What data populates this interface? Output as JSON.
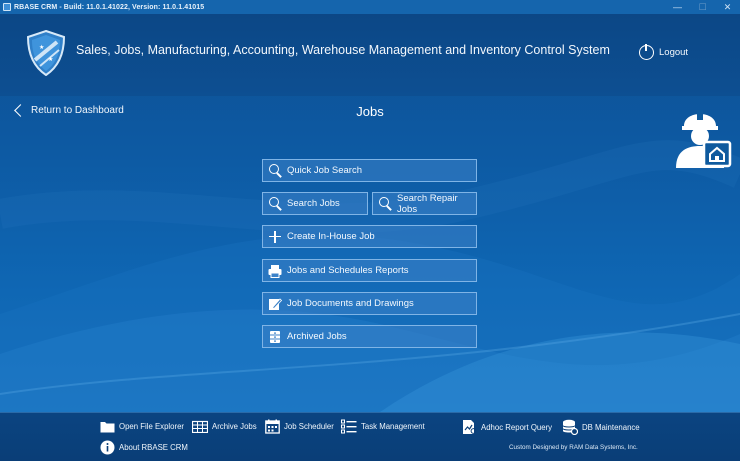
{
  "window": {
    "title": "RBASE CRM - Build: 11.0.1.41022, Version: 11.0.1.41015",
    "controls": {
      "minimize": "—",
      "maximize": "☐",
      "close": "✕"
    }
  },
  "header": {
    "title": "Sales, Jobs, Manufacturing, Accounting, Warehouse Management and Inventory Control System",
    "logout_label": "Logout"
  },
  "nav": {
    "back_label": "Return to Dashboard",
    "page_title": "Jobs"
  },
  "menu": {
    "quick_job_search": "Quick Job Search",
    "search_jobs": "Search Jobs",
    "search_repair_jobs": "Search Repair Jobs",
    "create_in_house_job": "Create In-House Job",
    "jobs_schedules_reports": "Jobs and Schedules Reports",
    "job_documents_drawings": "Job Documents and Drawings",
    "archived_jobs": "Archived Jobs"
  },
  "footer": {
    "open_file_explorer": "Open File Explorer",
    "archive_jobs": "Archive Jobs",
    "job_scheduler": "Job Scheduler",
    "task_management": "Task Management",
    "adhoc_report_query": "Adhoc Report Query",
    "db_maintenance": "DB Maintenance",
    "about": "About RBASE CRM",
    "credit": "Custom Designed by RAM Data Systems, Inc."
  },
  "colors": {
    "background": "#0f5a9e",
    "header": "#0c4786",
    "button_border": "#7fb4e6",
    "footer": "#0a3e77"
  }
}
